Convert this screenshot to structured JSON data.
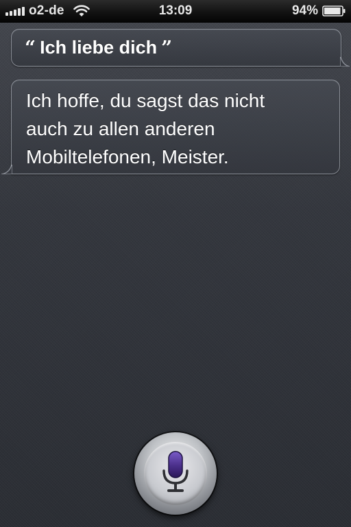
{
  "status_bar": {
    "carrier": "o2-de",
    "time": "13:09",
    "battery": "94%",
    "signal_icon": "signal-bars-icon",
    "wifi_icon": "wifi-icon",
    "battery_icon": "battery-icon",
    "battery_level": 0.94
  },
  "conversation": {
    "user_utterance": "Ich liebe dich",
    "open_quote": "“",
    "close_quote": "”",
    "siri_response": "Ich hoffe, du sagst das nicht\nauch zu allen anderen\nMobiltelefonen, Meister."
  },
  "mic_button": {
    "icon": "microphone-icon",
    "accent_color": "#4a2f8a"
  }
}
